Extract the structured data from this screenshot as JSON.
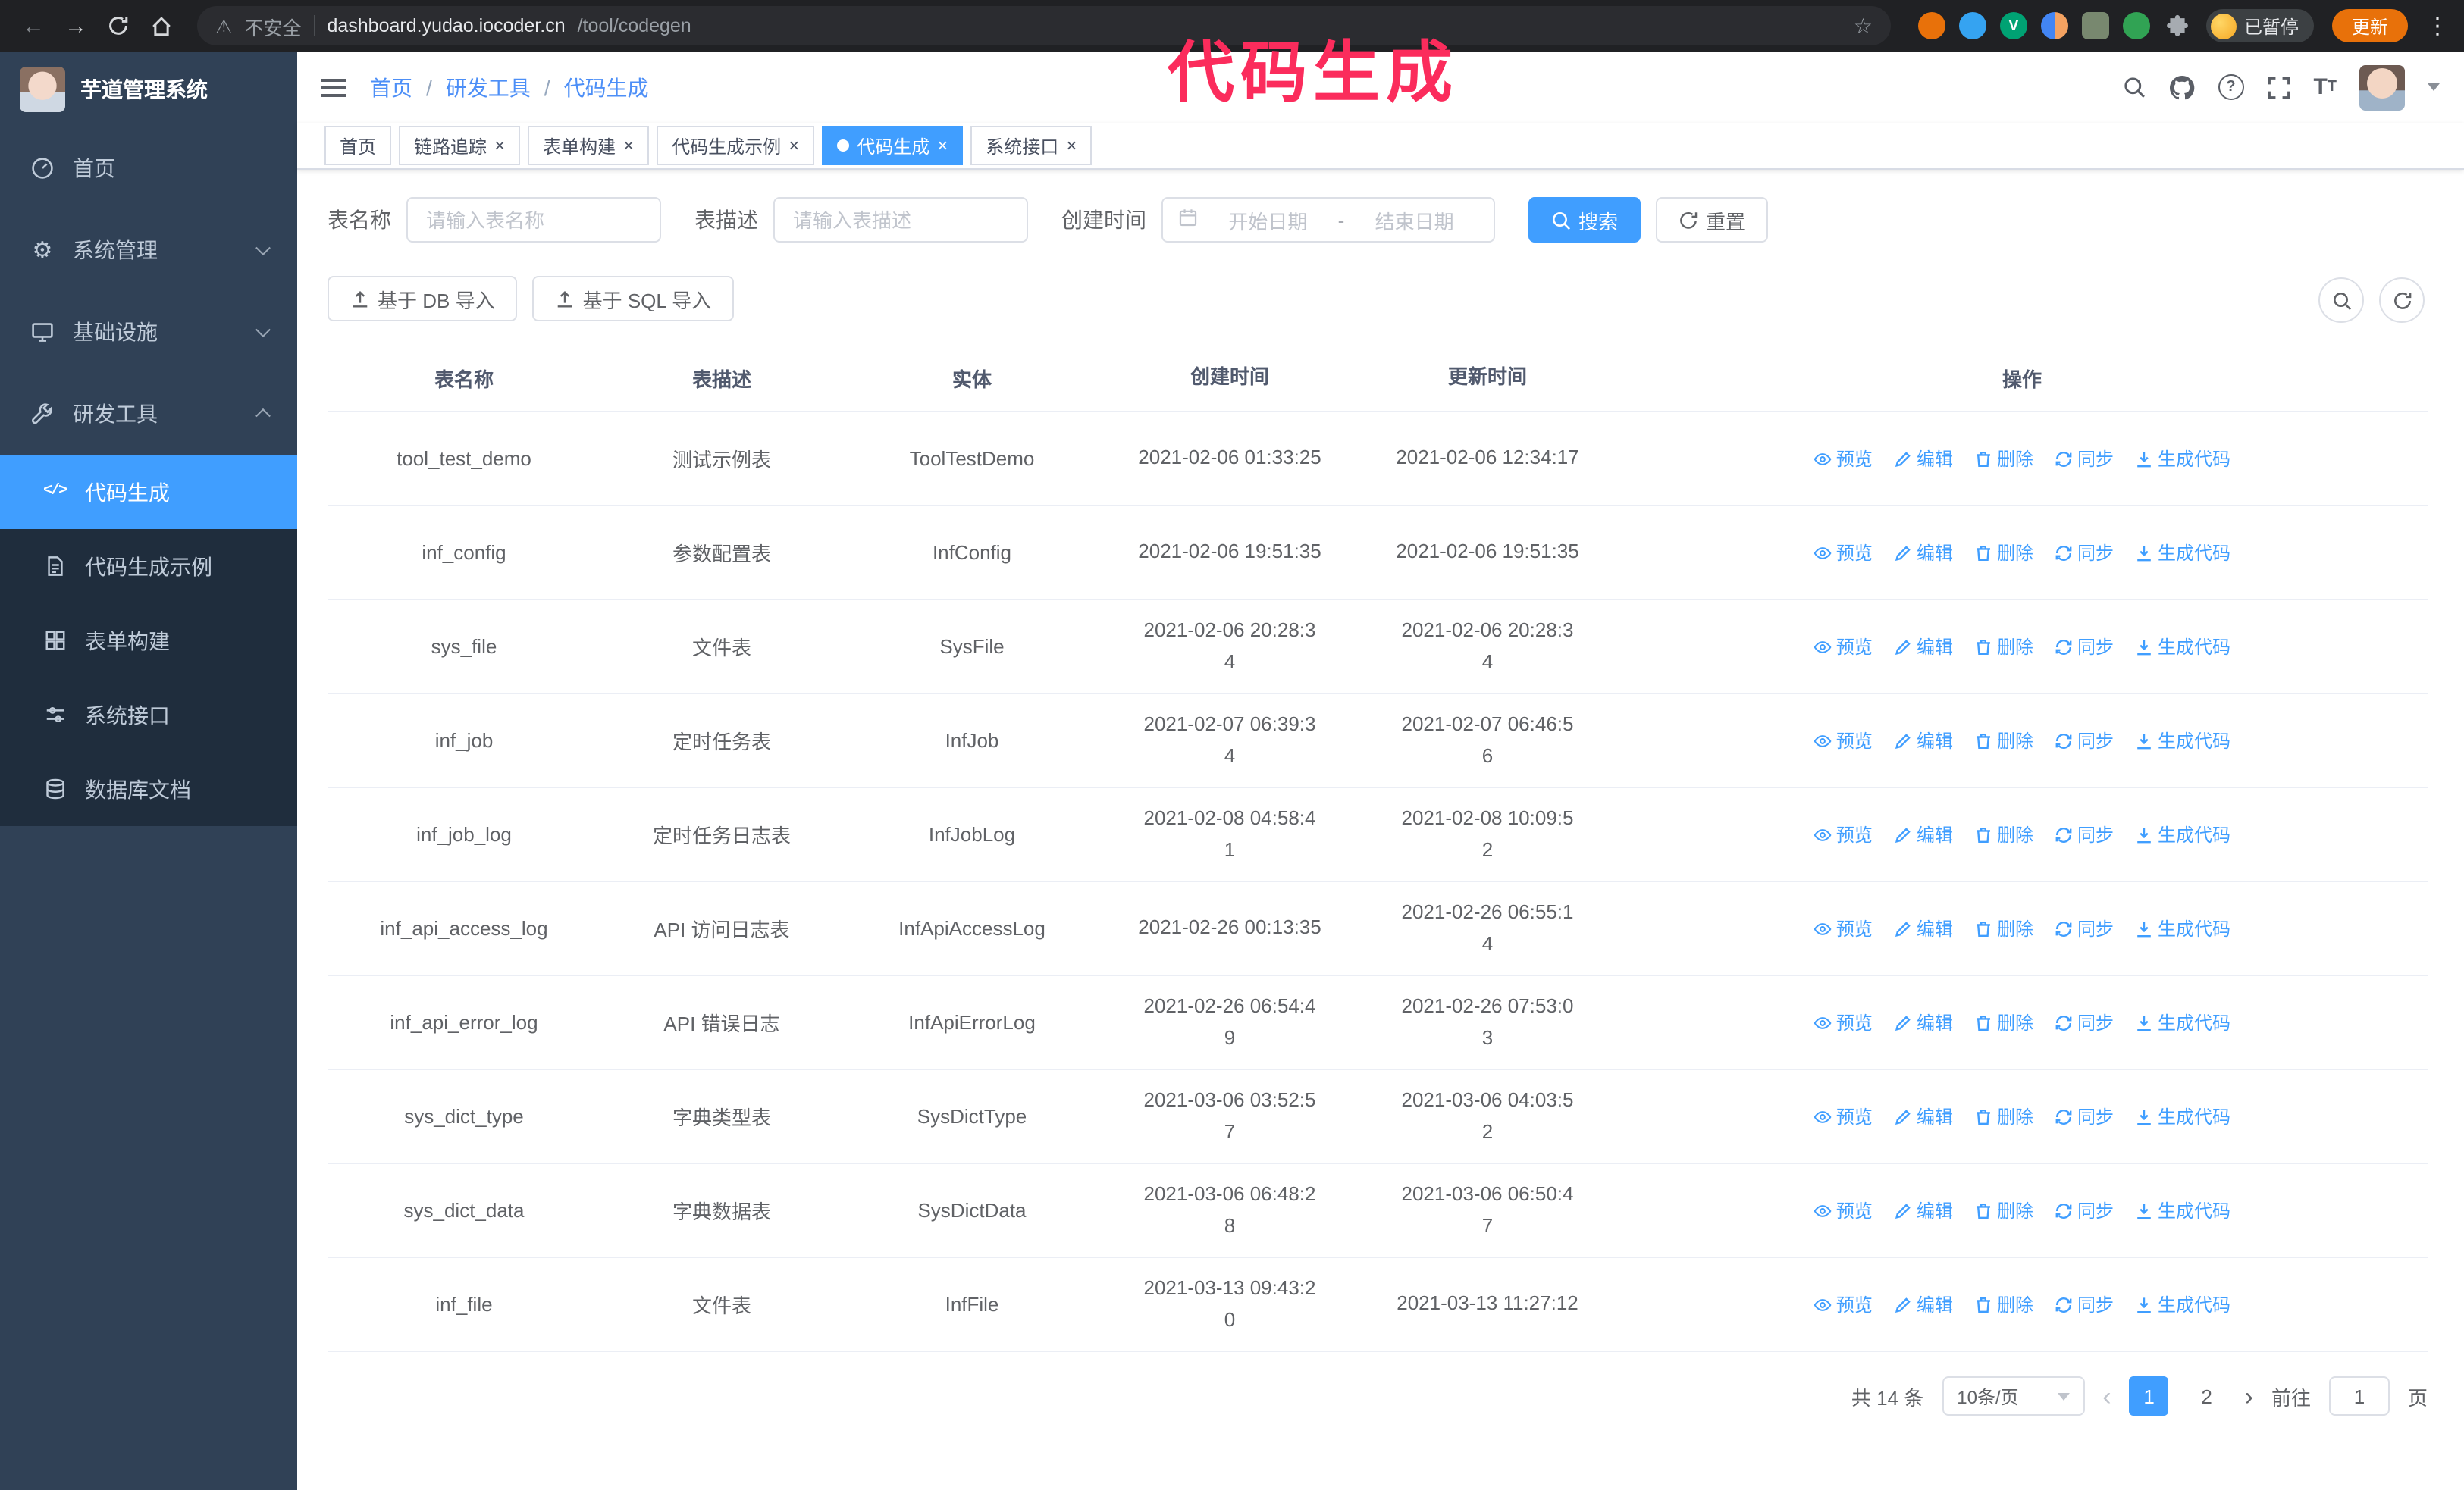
{
  "annotation": {
    "text": "代码生成",
    "color": "#fb2c5c"
  },
  "browser": {
    "security_label": "不安全",
    "url_host": "dashboard.yudao.iocoder.cn",
    "url_path": "/tool/codegen",
    "ext3_letter": "V",
    "paused_badge": "已暂停",
    "update_button": "更新"
  },
  "glyphs": {
    "gear": "⚙",
    "code": "</>"
  },
  "sidebar": {
    "logo_title": "芋道管理系统",
    "items": [
      {
        "label": "首页"
      },
      {
        "label": "系统管理"
      },
      {
        "label": "基础设施"
      },
      {
        "label": "研发工具"
      }
    ],
    "submenu": [
      {
        "label": "代码生成"
      },
      {
        "label": "代码生成示例"
      },
      {
        "label": "表单构建"
      },
      {
        "label": "系统接口"
      },
      {
        "label": "数据库文档"
      }
    ]
  },
  "header": {
    "breadcrumb": [
      "首页",
      "研发工具",
      "代码生成"
    ]
  },
  "tabs": [
    {
      "label": "首页"
    },
    {
      "label": "链路追踪"
    },
    {
      "label": "表单构建"
    },
    {
      "label": "代码生成示例"
    },
    {
      "label": "代码生成"
    },
    {
      "label": "系统接口"
    }
  ],
  "filters": {
    "table_name_label": "表名称",
    "table_name_placeholder": "请输入表名称",
    "table_desc_label": "表描述",
    "table_desc_placeholder": "请输入表描述",
    "create_time_label": "创建时间",
    "date_start_placeholder": "开始日期",
    "date_separator": "-",
    "date_end_placeholder": "结束日期",
    "search_button": "搜索",
    "reset_button": "重置"
  },
  "toolbar": {
    "import_db": "基于 DB 导入",
    "import_sql": "基于 SQL 导入"
  },
  "table": {
    "columns": [
      "表名称",
      "表描述",
      "实体",
      "创建时间",
      "更新时间",
      "操作"
    ],
    "actions": {
      "preview": "预览",
      "edit": "编辑",
      "delete": "删除",
      "sync": "同步",
      "generate": "生成代码"
    },
    "rows": [
      {
        "name": "tool_test_demo",
        "desc": "测试示例表",
        "entity": "ToolTestDemo",
        "created": "2021-02-06 01:33:25",
        "updated": "2021-02-06 12:34:17"
      },
      {
        "name": "inf_config",
        "desc": "参数配置表",
        "entity": "InfConfig",
        "created": "2021-02-06 19:51:35",
        "updated": "2021-02-06 19:51:35"
      },
      {
        "name": "sys_file",
        "desc": "文件表",
        "entity": "SysFile",
        "created": "2021-02-06 20:28:3\n4",
        "updated": "2021-02-06 20:28:3\n4"
      },
      {
        "name": "inf_job",
        "desc": "定时任务表",
        "entity": "InfJob",
        "created": "2021-02-07 06:39:3\n4",
        "updated": "2021-02-07 06:46:5\n6"
      },
      {
        "name": "inf_job_log",
        "desc": "定时任务日志表",
        "entity": "InfJobLog",
        "created": "2021-02-08 04:58:4\n1",
        "updated": "2021-02-08 10:09:5\n2"
      },
      {
        "name": "inf_api_access_log",
        "desc": "API 访问日志表",
        "entity": "InfApiAccessLog",
        "created": "2021-02-26 00:13:35",
        "updated": "2021-02-26 06:55:1\n4"
      },
      {
        "name": "inf_api_error_log",
        "desc": "API 错误日志",
        "entity": "InfApiErrorLog",
        "created": "2021-02-26 06:54:4\n9",
        "updated": "2021-02-26 07:53:0\n3"
      },
      {
        "name": "sys_dict_type",
        "desc": "字典类型表",
        "entity": "SysDictType",
        "created": "2021-03-06 03:52:5\n7",
        "updated": "2021-03-06 04:03:5\n2"
      },
      {
        "name": "sys_dict_data",
        "desc": "字典数据表",
        "entity": "SysDictData",
        "created": "2021-03-06 06:48:2\n8",
        "updated": "2021-03-06 06:50:4\n7"
      },
      {
        "name": "inf_file",
        "desc": "文件表",
        "entity": "InfFile",
        "created": "2021-03-13 09:43:2\n0",
        "updated": "2021-03-13 11:27:12"
      }
    ]
  },
  "pagination": {
    "total": "共 14 条",
    "page_size": "10条/页",
    "pages": [
      "1",
      "2"
    ],
    "active_page": "1",
    "goto_label": "前往",
    "goto_value": "1",
    "goto_suffix": "页"
  },
  "colors": {
    "accent": "#409eff",
    "sidebar_bg": "#304156",
    "submenu_bg": "#1f2d3d"
  }
}
